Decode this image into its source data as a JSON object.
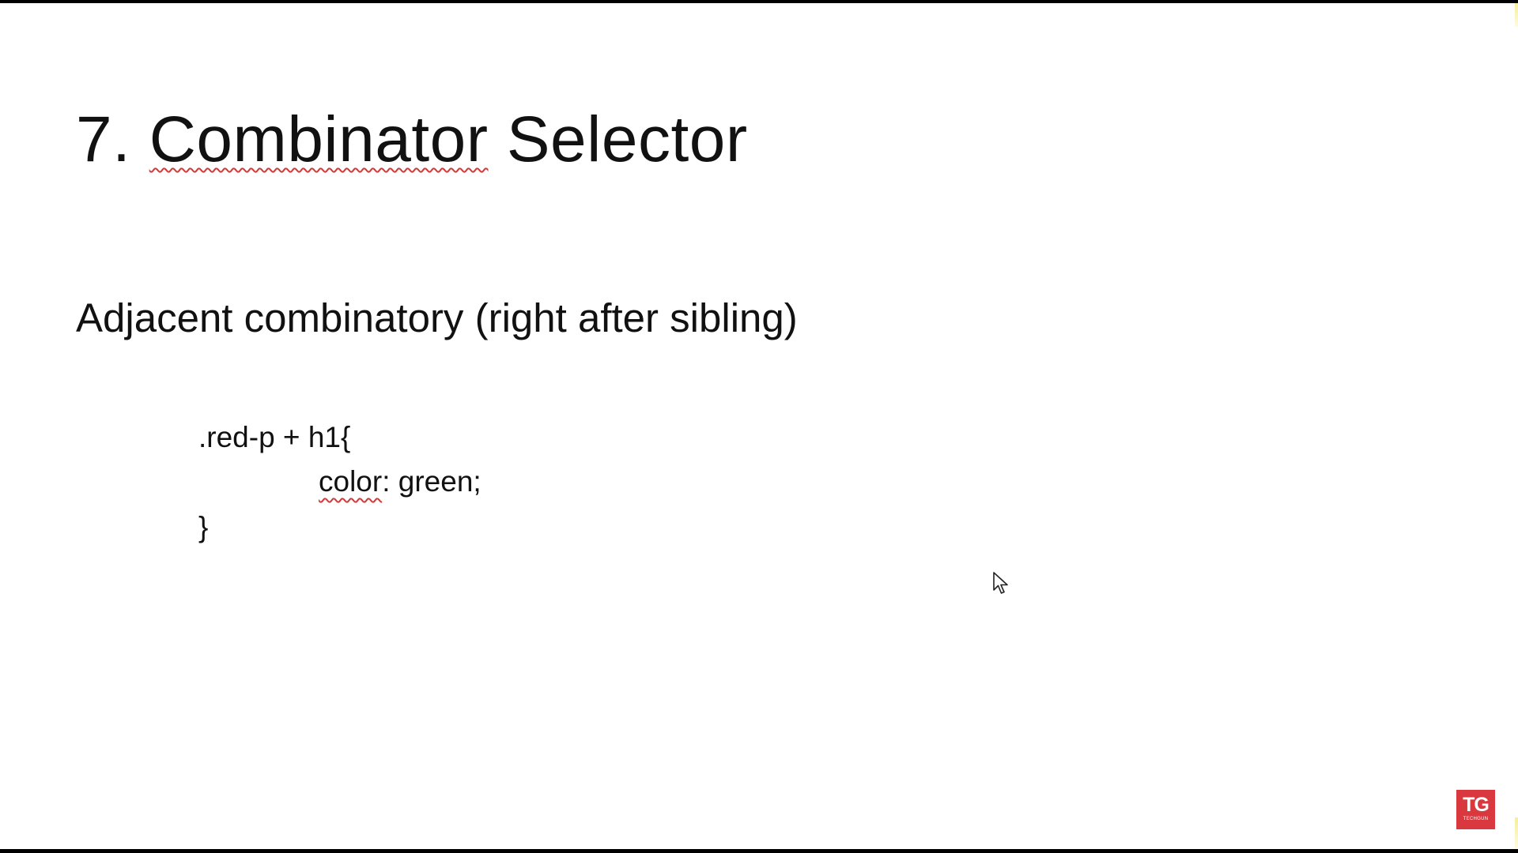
{
  "slide": {
    "title_prefix": "7.",
    "title_word_flagged": "Combinator",
    "title_suffix": "Selector",
    "subtitle": "Adjacent combinatory (right after sibling)",
    "code": {
      "line1": ".red-p + h1{",
      "line2_property": "color",
      "line2_rest": ": green;",
      "line3": "}"
    }
  },
  "branding": {
    "logo_mark": "TG",
    "logo_text": "TECHGUN",
    "logo_color": "#d9383f"
  },
  "colors": {
    "spellcheck_underline": "#d23a3a",
    "frame_border": "#000000"
  }
}
